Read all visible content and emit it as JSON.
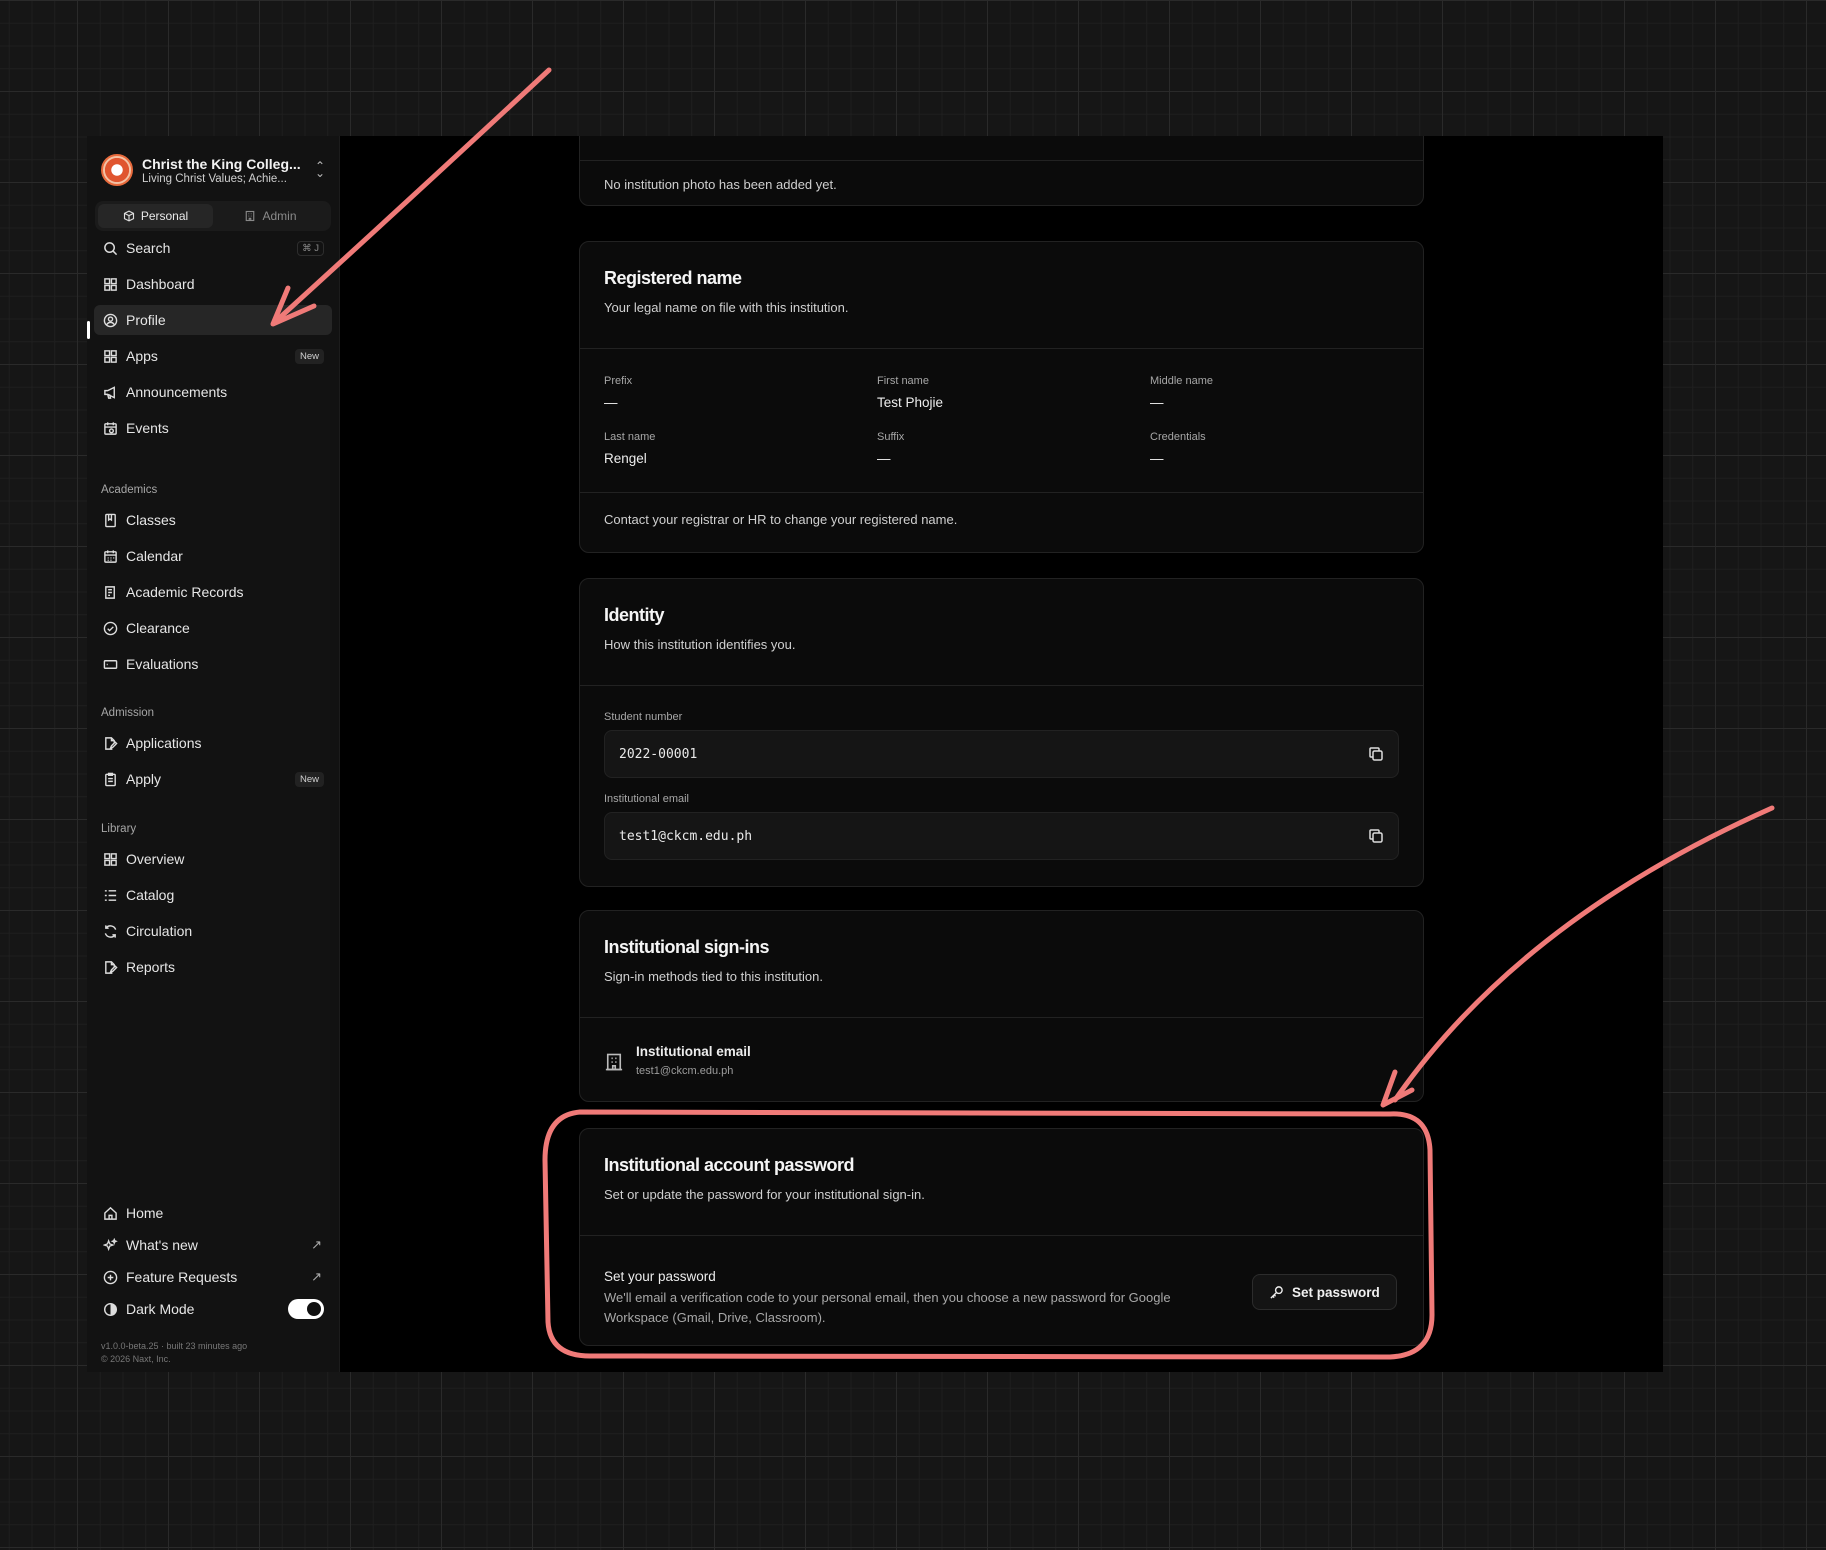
{
  "org": {
    "name": "Christ the King Colleg...",
    "tagline": "Living Christ Values; Achie..."
  },
  "mode_switch": {
    "personal": "Personal",
    "admin": "Admin"
  },
  "nav": {
    "search": {
      "label": "Search",
      "shortcut": "⌘ J"
    },
    "dashboard": "Dashboard",
    "profile": "Profile",
    "apps": {
      "label": "Apps",
      "badge": "New"
    },
    "announcements": "Announcements",
    "events": "Events"
  },
  "academics": {
    "heading": "Academics",
    "classes": "Classes",
    "calendar": "Calendar",
    "records": "Academic Records",
    "clearance": "Clearance",
    "evaluations": "Evaluations"
  },
  "admission": {
    "heading": "Admission",
    "applications": "Applications",
    "apply": {
      "label": "Apply",
      "badge": "New"
    }
  },
  "library": {
    "heading": "Library",
    "overview": "Overview",
    "catalog": "Catalog",
    "circulation": "Circulation",
    "reports": "Reports"
  },
  "footer_nav": {
    "home": "Home",
    "whats_new": "What's new",
    "feature_requests": "Feature Requests",
    "dark_mode": "Dark Mode",
    "dark_mode_on": true
  },
  "version": {
    "line1": "v1.0.0-beta.25 · built 23 minutes ago",
    "line2": "© 2026 Naxt, Inc."
  },
  "photo_card": {
    "message": "No institution photo has been added yet."
  },
  "registered_name": {
    "title": "Registered name",
    "description": "Your legal name on file with this institution.",
    "prefix_label": "Prefix",
    "prefix": "—",
    "first_label": "First name",
    "first": "Test Phojie",
    "middle_label": "Middle name",
    "middle": "—",
    "last_label": "Last name",
    "last": "Rengel",
    "suffix_label": "Suffix",
    "suffix": "—",
    "credentials_label": "Credentials",
    "credentials": "—",
    "footer": "Contact your registrar or HR to change your registered name."
  },
  "identity": {
    "title": "Identity",
    "description": "How this institution identifies you.",
    "student_number_label": "Student number",
    "student_number": "2022-00001",
    "email_label": "Institutional email",
    "email": "test1@ckcm.edu.ph"
  },
  "signins": {
    "title": "Institutional sign-ins",
    "description": "Sign-in methods tied to this institution.",
    "method_title": "Institutional email",
    "method_value": "test1@ckcm.edu.ph"
  },
  "password": {
    "title": "Institutional account password",
    "description": "Set or update the password for your institutional sign-in.",
    "row_title": "Set your password",
    "row_desc_1": "We'll email a verification code to your personal email, then you choose a new password for Google",
    "row_desc_2": "Workspace (Gmail, Drive, Classroom).",
    "button": "Set password"
  },
  "annotation_color": "#f07a78"
}
